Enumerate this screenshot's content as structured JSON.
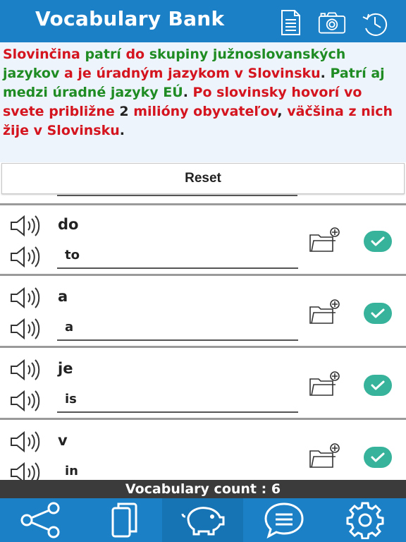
{
  "header": {
    "title": "Vocabulary Bank",
    "icons": [
      "document-icon",
      "camera-icon",
      "history-icon"
    ],
    "color": "#1b80c6"
  },
  "sentence": {
    "tokens": [
      {
        "text": "Slovinčina",
        "color": "red"
      },
      {
        "text": " ",
        "color": "black"
      },
      {
        "text": "patrí",
        "color": "green"
      },
      {
        "text": " ",
        "color": "black"
      },
      {
        "text": "do",
        "color": "red"
      },
      {
        "text": " ",
        "color": "black"
      },
      {
        "text": "skupiny",
        "color": "green"
      },
      {
        "text": " ",
        "color": "black"
      },
      {
        "text": "južnoslovanských",
        "color": "green"
      },
      {
        "text": " ",
        "color": "black"
      },
      {
        "text": "jazykov",
        "color": "green"
      },
      {
        "text": " ",
        "color": "black"
      },
      {
        "text": "a",
        "color": "red"
      },
      {
        "text": " ",
        "color": "black"
      },
      {
        "text": "je",
        "color": "red"
      },
      {
        "text": " ",
        "color": "black"
      },
      {
        "text": "úradným",
        "color": "red"
      },
      {
        "text": " ",
        "color": "black"
      },
      {
        "text": "jazykom",
        "color": "red"
      },
      {
        "text": " ",
        "color": "black"
      },
      {
        "text": "v",
        "color": "red"
      },
      {
        "text": " ",
        "color": "black"
      },
      {
        "text": "Slovinsku",
        "color": "red"
      },
      {
        "text": ". ",
        "color": "black"
      },
      {
        "text": "Patrí",
        "color": "green"
      },
      {
        "text": " ",
        "color": "black"
      },
      {
        "text": "aj",
        "color": "green"
      },
      {
        "text": " ",
        "color": "black"
      },
      {
        "text": "medzi",
        "color": "green"
      },
      {
        "text": " ",
        "color": "black"
      },
      {
        "text": "úradné",
        "color": "green"
      },
      {
        "text": " ",
        "color": "black"
      },
      {
        "text": "jazyky",
        "color": "green"
      },
      {
        "text": " ",
        "color": "black"
      },
      {
        "text": "EÚ",
        "color": "green"
      },
      {
        "text": ". ",
        "color": "black"
      },
      {
        "text": "Po",
        "color": "red"
      },
      {
        "text": " ",
        "color": "black"
      },
      {
        "text": "slovinsky",
        "color": "red"
      },
      {
        "text": " ",
        "color": "black"
      },
      {
        "text": "hovorí",
        "color": "red"
      },
      {
        "text": " ",
        "color": "black"
      },
      {
        "text": "vo",
        "color": "red"
      },
      {
        "text": " ",
        "color": "black"
      },
      {
        "text": "svete",
        "color": "red"
      },
      {
        "text": " ",
        "color": "black"
      },
      {
        "text": "približne",
        "color": "red"
      },
      {
        "text": " 2 ",
        "color": "black"
      },
      {
        "text": "milióny",
        "color": "red"
      },
      {
        "text": " ",
        "color": "black"
      },
      {
        "text": "obyvateľov",
        "color": "red"
      },
      {
        "text": ", ",
        "color": "black"
      },
      {
        "text": "väčšina",
        "color": "red"
      },
      {
        "text": " ",
        "color": "black"
      },
      {
        "text": "z",
        "color": "red"
      },
      {
        "text": " ",
        "color": "black"
      },
      {
        "text": "nich",
        "color": "red"
      },
      {
        "text": " ",
        "color": "black"
      },
      {
        "text": "žije",
        "color": "red"
      },
      {
        "text": " ",
        "color": "black"
      },
      {
        "text": "v",
        "color": "red"
      },
      {
        "text": " ",
        "color": "black"
      },
      {
        "text": "Slovinsku",
        "color": "red"
      },
      {
        "text": ".",
        "color": "black"
      }
    ],
    "colors": {
      "red": "#d4141e",
      "green": "#1f8c23",
      "black": "#222222"
    }
  },
  "reset_label": "Reset",
  "rows": [
    {
      "word": "do",
      "translation": "to"
    },
    {
      "word": "a",
      "translation": "a"
    },
    {
      "word": "je",
      "translation": "is"
    },
    {
      "word": "v",
      "translation": "in"
    }
  ],
  "footer": {
    "count_text": "Vocabulary count : 6",
    "tabs": [
      "share-icon",
      "cards-icon",
      "piggy-bank-icon",
      "chat-icon",
      "settings-icon"
    ],
    "active_tab": 2,
    "check_color": "#38b39b"
  }
}
